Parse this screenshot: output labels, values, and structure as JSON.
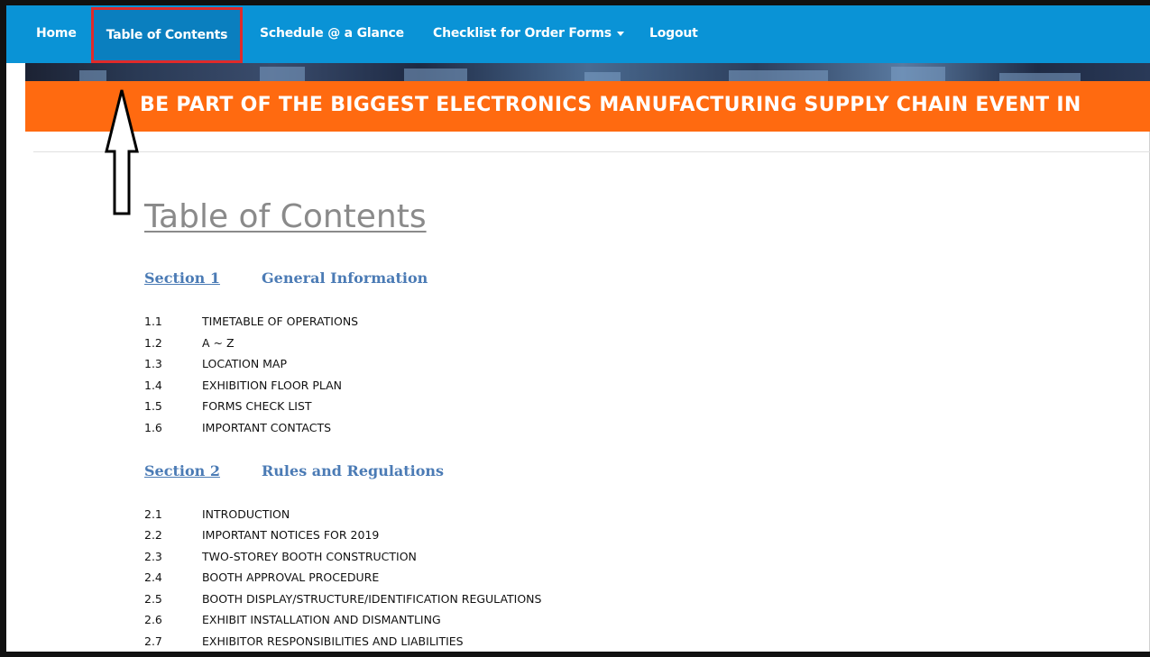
{
  "nav": {
    "items": [
      {
        "label": "Home"
      },
      {
        "label": "Table of Contents",
        "active": true
      },
      {
        "label": "Schedule @ a Glance"
      },
      {
        "label": "Checklist for Order Forms",
        "dropdown": true
      },
      {
        "label": "Logout"
      }
    ]
  },
  "banner": {
    "text": "BE PART OF THE BIGGEST ELECTRONICS MANUFACTURING SUPPLY CHAIN EVENT IN"
  },
  "page": {
    "title": "Table of Contents"
  },
  "sections": [
    {
      "number": "Section 1",
      "title": "General Information",
      "items": [
        {
          "num": "1.1",
          "title": "TIMETABLE OF OPERATIONS"
        },
        {
          "num": "1.2",
          "title": "A ~ Z"
        },
        {
          "num": "1.3",
          "title": "LOCATION MAP"
        },
        {
          "num": "1.4",
          "title": "EXHIBITION FLOOR PLAN"
        },
        {
          "num": "1.5",
          "title": "FORMS CHECK LIST"
        },
        {
          "num": "1.6",
          "title": "IMPORTANT CONTACTS"
        }
      ]
    },
    {
      "number": "Section 2",
      "title": "Rules and Regulations",
      "items": [
        {
          "num": "2.1",
          "title": "INTRODUCTION"
        },
        {
          "num": "2.2",
          "title": "IMPORTANT NOTICES FOR 2019"
        },
        {
          "num": "2.3",
          "title": "TWO-STOREY BOOTH CONSTRUCTION"
        },
        {
          "num": "2.4",
          "title": "BOOTH APPROVAL PROCEDURE"
        },
        {
          "num": "2.5",
          "title": "BOOTH DISPLAY/STRUCTURE/IDENTIFICATION REGULATIONS"
        },
        {
          "num": "2.6",
          "title": "EXHIBIT INSTALLATION AND DISMANTLING"
        },
        {
          "num": "2.7",
          "title": "EXHIBITOR RESPONSIBILITIES AND LIABILITIES"
        }
      ]
    }
  ],
  "colors": {
    "navbar": "#0a93d6",
    "highlight_box": "#e02a2a",
    "banner": "#ff6a10",
    "section_link": "#4b7bb5",
    "title": "#8a8a8a"
  },
  "icons": {
    "annotation": "up-arrow-icon",
    "dropdown": "caret-down-icon"
  }
}
